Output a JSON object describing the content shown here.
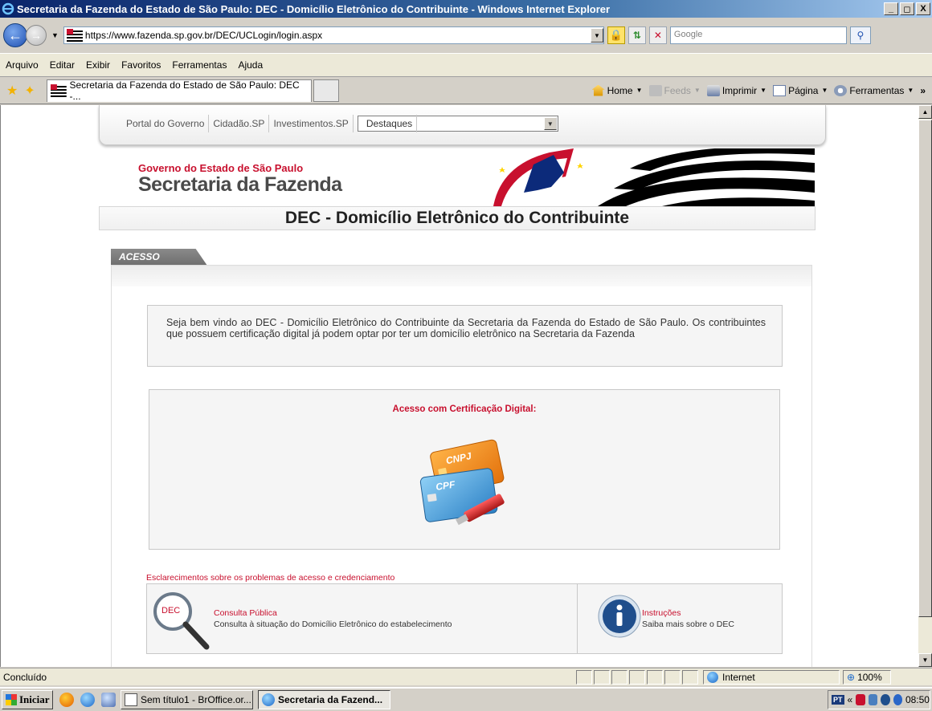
{
  "window": {
    "title": "Secretaria da Fazenda do Estado de São Paulo: DEC - Domicílio Eletrônico do Contribuinte - Windows Internet Explorer",
    "minimize": "_",
    "maximize": "◻",
    "close": "X"
  },
  "address": {
    "url": "https://www.fazenda.sp.gov.br/DEC/UCLogin/login.aspx",
    "search_placeholder": "Google"
  },
  "menu": [
    "Arquivo",
    "Editar",
    "Exibir",
    "Favoritos",
    "Ferramentas",
    "Ajuda"
  ],
  "tab": {
    "label": "Secretaria da Fazenda do Estado de São Paulo: DEC -..."
  },
  "command_bar": {
    "home": "Home",
    "feeds": "Feeds",
    "print": "Imprimir",
    "page": "Página",
    "tools": "Ferramentas",
    "more": "»"
  },
  "page": {
    "topnav": {
      "links": [
        "Portal do Governo",
        "Cidadão.SP",
        "Investimentos.SP"
      ],
      "select_value": "Destaques"
    },
    "banner": {
      "government": "Governo do Estado de São Paulo",
      "secretaria": "Secretaria da Fazenda"
    },
    "title": "DEC - Domicílio Eletrônico do Contribuinte",
    "tab_label": "ACESSO",
    "welcome": "Seja bem vindo ao DEC - Domicílio Eletrônico do Contribuinte da Secretaria da Fazenda do Estado de São Paulo. Os contribuintes que possuem certificação digital já podem optar por ter um domicílio eletrônico na Secretaria da Fazenda",
    "cert_label": "Acesso com Certificação Digital:",
    "card_labels": {
      "cnpj": "CNPJ",
      "cpf": "CPF"
    },
    "help_link": "Esclarecimentos sobre os problemas de acesso e credenciamento",
    "consulta": {
      "icon_text": "DEC",
      "title": "Consulta Pública",
      "description": "Consulta à situação do Domicílio Eletrônico do estabelecimento"
    },
    "instrucoes": {
      "title": "Instruções",
      "description": "Saiba mais sobre o DEC"
    }
  },
  "status": {
    "message": "Concluído",
    "zone": "Internet",
    "zoom": "100%"
  },
  "taskbar": {
    "start": "Iniciar",
    "tasks": [
      "Sem título1 - BrOffice.or...",
      "Secretaria da Fazend..."
    ],
    "language": "PT",
    "clock": "08:50"
  },
  "colors": {
    "accent_red": "#c8102e",
    "xp_title_blue": "#0a246a"
  }
}
